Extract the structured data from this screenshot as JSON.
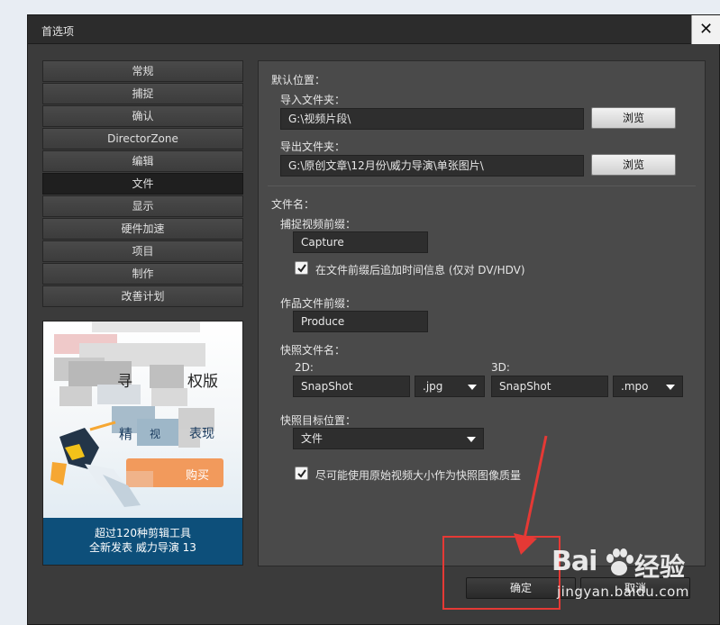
{
  "window": {
    "title": "首选项",
    "close_glyph": "✕"
  },
  "sidebar": {
    "items": [
      {
        "label": "常规",
        "active": false
      },
      {
        "label": "捕捉",
        "active": false
      },
      {
        "label": "确认",
        "active": false
      },
      {
        "label": "DirectorZone",
        "active": false
      },
      {
        "label": "编辑",
        "active": false
      },
      {
        "label": "文件",
        "active": true
      },
      {
        "label": "显示",
        "active": false
      },
      {
        "label": "硬件加速",
        "active": false
      },
      {
        "label": "项目",
        "active": false
      },
      {
        "label": "制作",
        "active": false
      },
      {
        "label": "改善计划",
        "active": false
      }
    ]
  },
  "promo": {
    "banner_text_1": "寻",
    "banner_text_2": "权版",
    "banner_text_3": "精",
    "banner_text_4": "视",
    "banner_text_5": "表现",
    "banner_button": "购买",
    "caption_line1": "超过120种剪辑工具",
    "caption_line2": "全新发表 威力导演 13"
  },
  "panel": {
    "default_location_label": "默认位置：",
    "import_folder_label": "导入文件夹：",
    "import_folder_value": "G:\\视频片段\\",
    "export_folder_label": "导出文件夹：",
    "export_folder_value": "G:\\原创文章\\12月份\\威力导演\\单张图片\\",
    "browse_label": "浏览",
    "filename_label": "文件名：",
    "capture_prefix_label": "捕捉视频前缀：",
    "capture_prefix_value": "Capture",
    "append_time_label": "在文件前缀后追加时间信息 (仅对 DV/HDV)",
    "append_time_checked": true,
    "production_prefix_label": "作品文件前缀：",
    "production_prefix_value": "Produce",
    "snapshot_name_label": "快照文件名：",
    "label_2d": "2D:",
    "snapshot_2d_value": "SnapShot",
    "format_2d": ".jpg",
    "label_3d": "3D:",
    "snapshot_3d_value": "SnapShot",
    "format_3d": ".mpo",
    "snapshot_target_label": "快照目标位置：",
    "snapshot_target_value": "文件",
    "original_size_label": "尽可能使用原始视频大小作为快照图像质量",
    "original_size_checked": true
  },
  "footer": {
    "ok_label": "确定",
    "cancel_label": "取消"
  },
  "watermark": {
    "brand_left": "Bai",
    "brand_right": "经验",
    "url": "jingyan.baidu.com"
  },
  "colors": {
    "dialog_bg": "#3b3b3b",
    "panel_bg": "#4a4a4a",
    "caption_bg": "#0d4f7a",
    "annotation": "#e53935"
  }
}
